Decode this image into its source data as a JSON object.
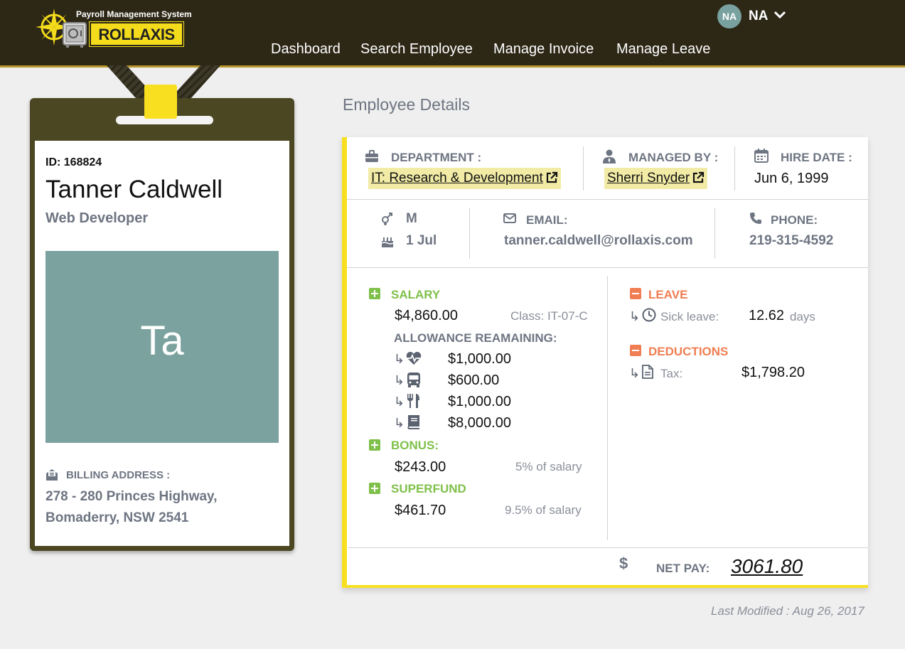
{
  "header": {
    "app_subtitle": "Payroll Management System",
    "brand_left": "ROLL",
    "brand_right": "AXIS",
    "user_initials": "NA",
    "user_name": "NA",
    "nav": [
      "Dashboard",
      "Search Employee",
      "Manage Invoice",
      "Manage Leave"
    ]
  },
  "badge": {
    "id_line": "ID: 168824",
    "name": "Tanner Caldwell",
    "job_title": "Web Developer",
    "photo_initials": "Ta",
    "billing_label": "BILLING ADDRESS :",
    "billing_line1": "278 - 280 Princes Highway,",
    "billing_line2": "Bomaderry, NSW 2541"
  },
  "details": {
    "section_title": "Employee Details",
    "department_label": "DEPARTMENT :",
    "department_value": "IT: Research & Development",
    "managed_label": "MANAGED BY :",
    "managed_value": "Sherri Snyder",
    "hire_label": "HIRE DATE :",
    "hire_value": "Jun 6, 1999",
    "gender": "M",
    "birthday": "1 Jul",
    "email_label": "EMAIL:",
    "email_value": "tanner.caldwell@rollaxis.com",
    "phone_label": "PHONE:",
    "phone_value": "219-315-4592"
  },
  "pay": {
    "salary_label": "SALARY",
    "salary_value": "$4,860.00",
    "salary_class": "Class: IT-07-C",
    "allowance_label": "ALLOWANCE REAMAINING:",
    "allowances": [
      "$1,000.00",
      "$600.00",
      "$1,000.00",
      "$8,000.00"
    ],
    "allowance_icons": [
      "heartbeat-icon",
      "bus-icon",
      "cutlery-icon",
      "book-icon"
    ],
    "arrow_glyph": "↳",
    "bonus_label": "BONUS:",
    "bonus_value": "$243.00",
    "bonus_note": "5% of salary",
    "super_label": "SUPERFUND",
    "super_value": "$461.70",
    "super_note": "9.5% of salary",
    "leave_label": "LEAVE",
    "sick_label": "Sick leave:",
    "sick_value": "12.62",
    "sick_unit": "days",
    "deductions_label": "DEDUCTIONS",
    "tax_label": "Tax:",
    "tax_value": "$1,798.20",
    "net_label": "NET PAY:",
    "net_value": "3061.80",
    "currency_symbol": "$"
  },
  "footer": {
    "last_modified": "Last Modified : Aug 26, 2017"
  },
  "colors": {
    "header_bg": "#2d2716",
    "accent_yellow": "#f8e021",
    "badge_olive": "#4b4722",
    "photo_teal": "#7ba29f",
    "positive_green": "#7fc04a",
    "negative_orange": "#f07e52",
    "muted_text": "#6e7582"
  }
}
